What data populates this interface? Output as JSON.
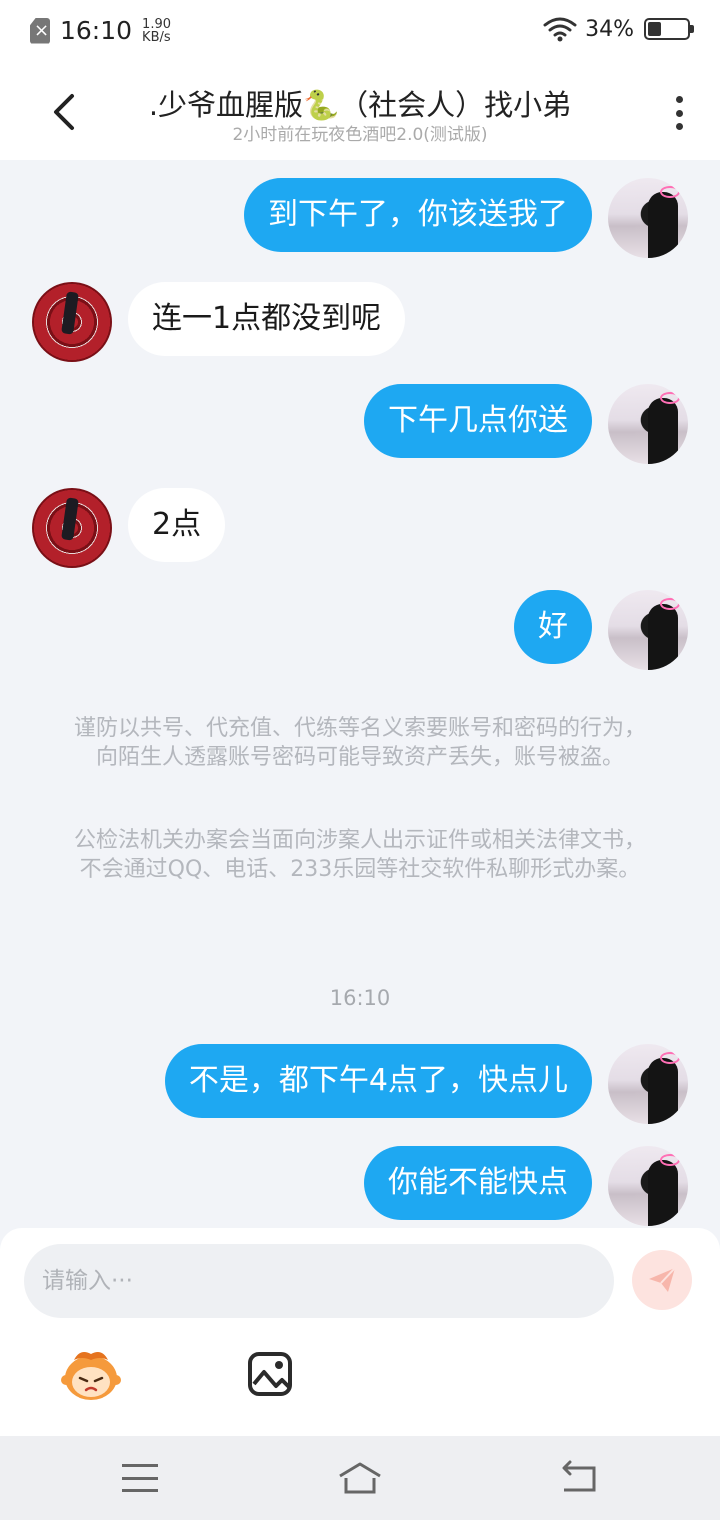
{
  "status_bar": {
    "time": "16:10",
    "speed_value": "1.90",
    "speed_unit": "KB/s",
    "battery_text": "34%",
    "battery_level": 0.34,
    "icons": [
      "sim-error-icon",
      "wifi-icon",
      "battery-icon"
    ]
  },
  "header": {
    "title": ".少爷血腥版🐍（社会人）找小弟",
    "subtitle": "2小时前在玩夜色酒吧2.0(测试版)"
  },
  "messages": [
    {
      "side": "me",
      "text": "到下午了，你该送我了"
    },
    {
      "side": "other",
      "text": "连一1点都没到呢"
    },
    {
      "side": "me",
      "text": "下午几点你送"
    },
    {
      "side": "other",
      "text": "2点"
    },
    {
      "side": "me",
      "text": "好"
    }
  ],
  "notices": [
    "谨防以共号、代充值、代练等名义索要账号和密码的行为，向陌生人透露账号密码可能导致资产丢失，账号被盗。",
    "公检法机关办案会当面向涉案人出示证件或相关法律文书，不会通过QQ、电话、233乐园等社交软件私聊形式办案。"
  ],
  "timestamp": "16:10",
  "messages_after": [
    {
      "side": "me",
      "text": "不是，都下午4点了，快点儿"
    },
    {
      "side": "me",
      "text": "你能不能快点"
    }
  ],
  "input": {
    "placeholder": "请输入···"
  },
  "colors": {
    "bubble_me": "#1ea8f2",
    "bubble_other": "#ffffff",
    "chat_background": "#f2f4f8",
    "send_button": "#fde3df"
  }
}
